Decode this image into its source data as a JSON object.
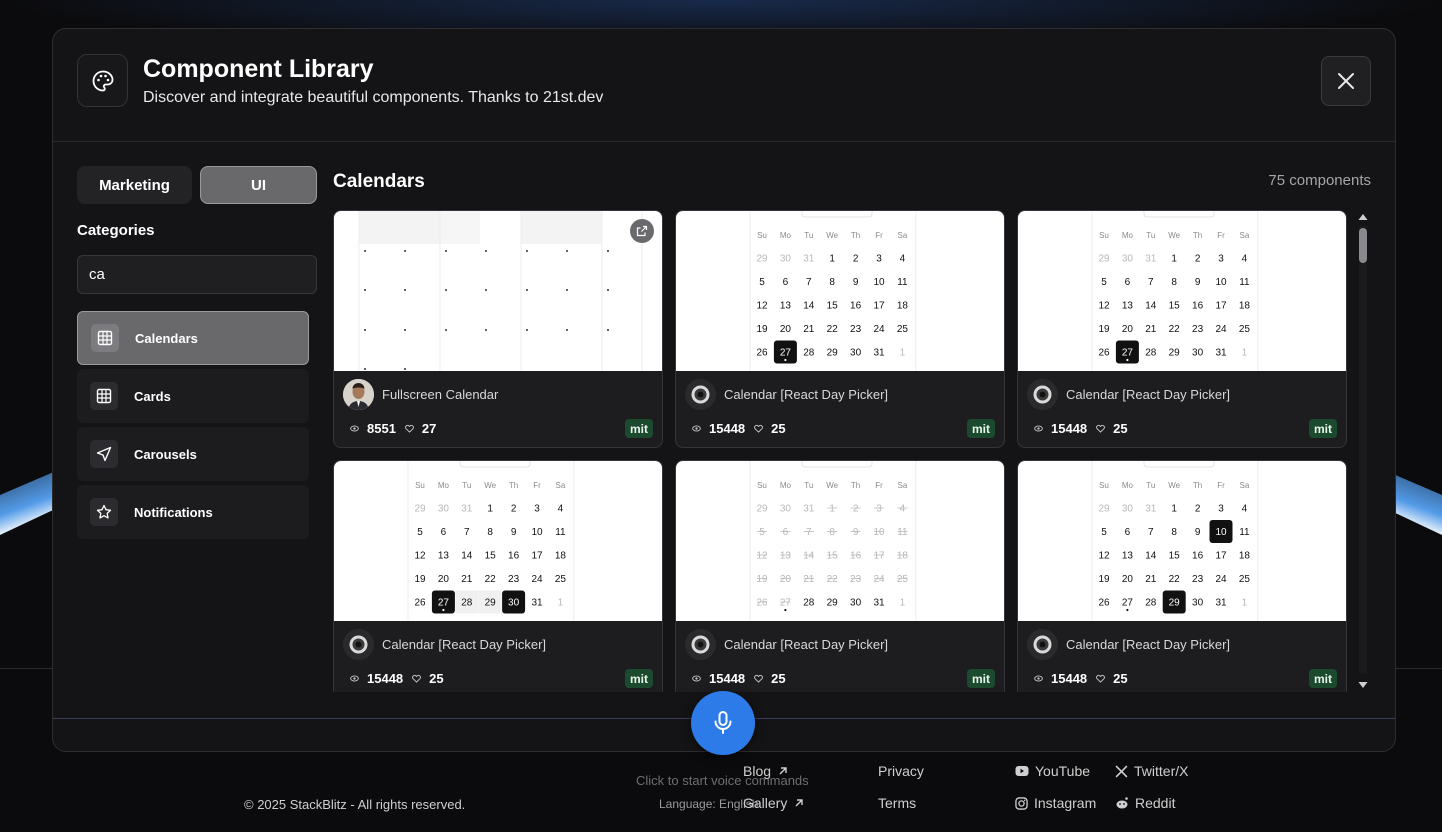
{
  "modal": {
    "title": "Component Library",
    "subtitle": "Discover and integrate beautiful components. Thanks to 21st.dev"
  },
  "tabs": [
    {
      "label": "Marketing",
      "active": false
    },
    {
      "label": "UI",
      "active": true
    }
  ],
  "sidebar": {
    "categories_label": "Categories",
    "search_value": "ca",
    "items": [
      {
        "label": "Calendars",
        "icon": "grid-icon",
        "active": true
      },
      {
        "label": "Cards",
        "icon": "grid-icon",
        "active": false
      },
      {
        "label": "Carousels",
        "icon": "send-icon",
        "active": false
      },
      {
        "label": "Notifications",
        "icon": "star-icon",
        "active": false
      }
    ]
  },
  "main": {
    "title": "Calendars",
    "count": "75 components",
    "cards": [
      {
        "name": "Fullscreen Calendar",
        "views": "8551",
        "likes": "27",
        "license": "mit",
        "avatar": "person-photo"
      },
      {
        "name": "Calendar [React Day Picker]",
        "views": "15448",
        "likes": "25",
        "license": "mit",
        "avatar": "default-avatar"
      },
      {
        "name": "Calendar [React Day Picker]",
        "views": "15448",
        "likes": "25",
        "license": "mit",
        "avatar": "default-avatar"
      },
      {
        "name": "Calendar [React Day Picker]",
        "views": "15448",
        "likes": "25",
        "license": "mit",
        "avatar": "default-avatar"
      },
      {
        "name": "Calendar [React Day Picker]",
        "views": "15448",
        "likes": "25",
        "license": "mit",
        "avatar": "default-avatar"
      },
      {
        "name": "Calendar [React Day Picker]",
        "views": "15448",
        "likes": "25",
        "license": "mit",
        "avatar": "default-avatar"
      }
    ],
    "calendar": {
      "weekdays": [
        "Su",
        "Mo",
        "Tu",
        "We",
        "Th",
        "Fr",
        "Sa"
      ],
      "rows": [
        [
          "29",
          "30",
          "31",
          "1",
          "2",
          "3",
          "4"
        ],
        [
          "5",
          "6",
          "7",
          "8",
          "9",
          "10",
          "11"
        ],
        [
          "12",
          "13",
          "14",
          "15",
          "16",
          "17",
          "18"
        ],
        [
          "19",
          "20",
          "21",
          "22",
          "23",
          "24",
          "25"
        ],
        [
          "26",
          "27",
          "28",
          "29",
          "30",
          "31",
          "1"
        ]
      ]
    }
  },
  "footer": {
    "copyright": "© 2025 StackBlitz - All rights reserved.",
    "voice_hint": "Click to start voice commands",
    "language": "Language: English",
    "links": {
      "blog": "Blog",
      "gallery": "Gallery",
      "privacy": "Privacy",
      "terms": "Terms",
      "youtube": "YouTube",
      "twitter": "Twitter/X",
      "instagram": "Instagram",
      "reddit": "Reddit"
    }
  },
  "colors": {
    "accent_blue": "#2d7be8",
    "license_badge": "#1c4a2f",
    "selected_day": "#111111"
  }
}
